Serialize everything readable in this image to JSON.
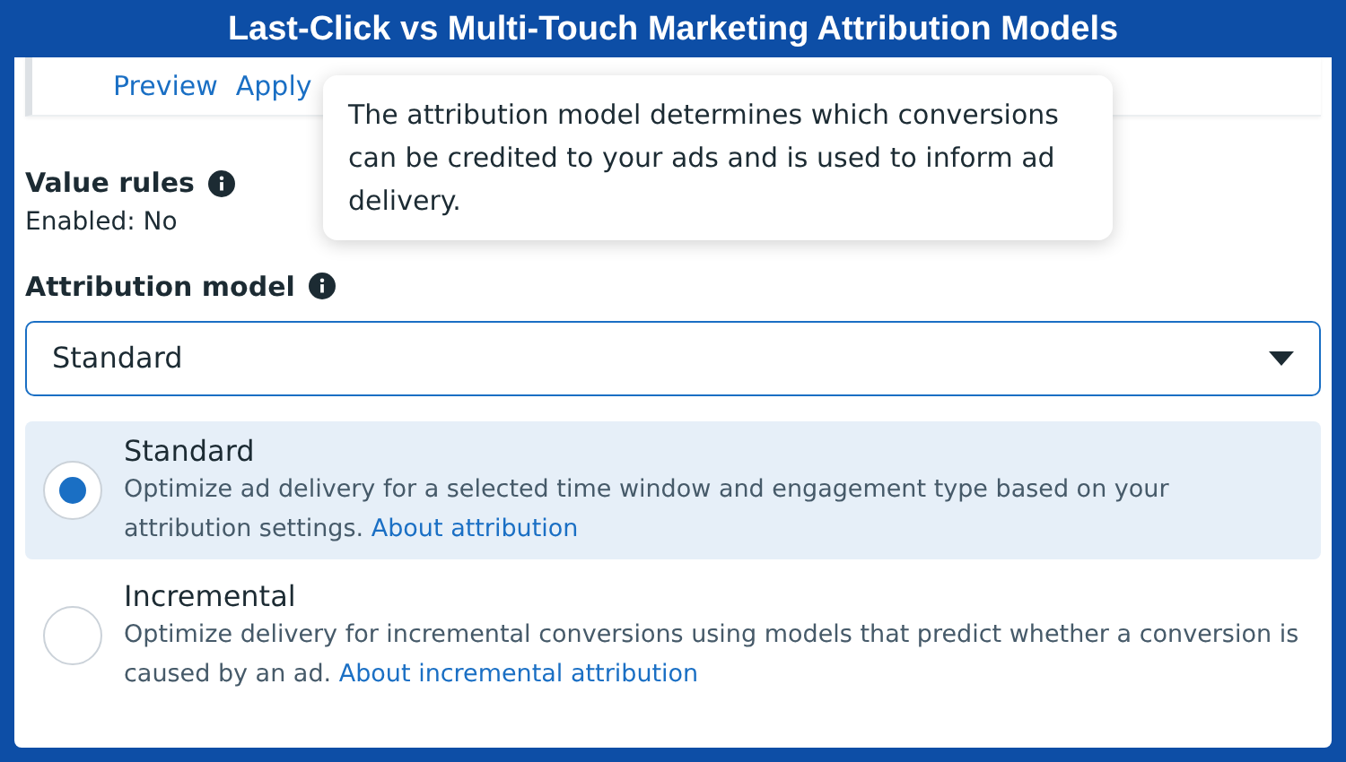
{
  "banner": {
    "title": "Last-Click vs Multi-Touch Marketing Attribution Models"
  },
  "preview_card": {
    "links": [
      "Preview",
      "Apply"
    ]
  },
  "tooltip": {
    "text": "The attribution model determines which conversions can be credited to your ads and is used to inform ad delivery."
  },
  "value_rules": {
    "label": "Value rules",
    "value": "Enabled: No"
  },
  "attribution_model": {
    "label": "Attribution model",
    "select_value": "Standard"
  },
  "options": [
    {
      "title": "Standard",
      "description": "Optimize ad delivery for a selected time window and engagement type based on your attribution settings.",
      "link": "About attribution",
      "selected": true
    },
    {
      "title": "Incremental",
      "description": "Optimize delivery for incremental conversions using models that predict whether a conversion is caused by an ad.",
      "link": "About incremental attribution",
      "selected": false
    }
  ]
}
